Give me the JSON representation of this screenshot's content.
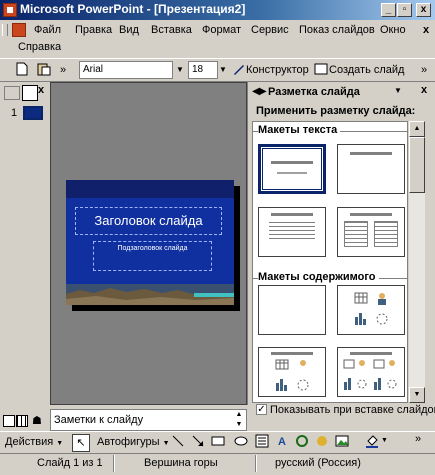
{
  "window": {
    "title": "Microsoft PowerPoint - [Презентация2]",
    "minimize_glyph": "_",
    "restore_glyph": "▫",
    "close_glyph": "x"
  },
  "menu": {
    "items": [
      "Файл",
      "Правка",
      "Вид",
      "Вставка",
      "Формат",
      "Сервис",
      "Показ слайдов",
      "Окно"
    ],
    "help": "Справка",
    "doc_close_glyph": "x"
  },
  "toolbar": {
    "font_name": "Arial",
    "font_size": "18",
    "designer_label": "Конструктор",
    "new_slide_label": "Создать слайд",
    "overflow_glyph": "»"
  },
  "left_pane": {
    "slide_number": "1",
    "close_glyph": "x"
  },
  "slide": {
    "title_placeholder": "Заголовок слайда",
    "subtitle_placeholder": "Подзаголовок слайда"
  },
  "task_pane": {
    "title": "Разметка слайда",
    "apply_label": "Применить разметку слайда:",
    "category_text": "Макеты текста",
    "category_content": "Макеты содержимого",
    "show_on_insert_label": "Показывать при вставке слайдов",
    "show_on_insert_checked": true,
    "check_glyph": "✓",
    "close_glyph": "x"
  },
  "notes": {
    "placeholder": "Заметки к слайду"
  },
  "drawing_toolbar": {
    "actions_label": "Действия",
    "autoshapes_label": "Автофигуры"
  },
  "status_bar": {
    "slide_info": "Слайд 1 из 1",
    "design": "Вершина горы",
    "language": "русский (Россия)"
  },
  "colors": {
    "titlebar_start": "#0a246a",
    "slide_background": "#1030a0",
    "chrome": "#d4d0c8"
  }
}
